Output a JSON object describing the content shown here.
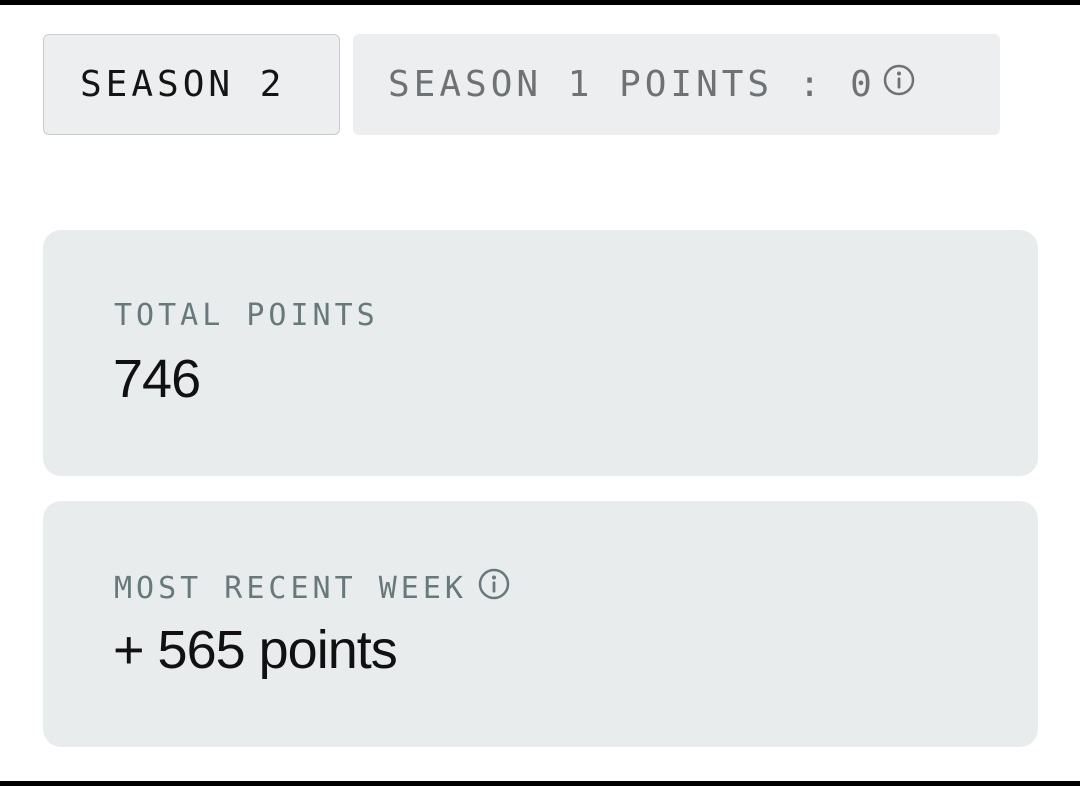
{
  "tabs": {
    "active": {
      "label": "SEASON 2"
    },
    "inactive": {
      "label": "SEASON 1 POINTS : 0",
      "icon": "info-icon"
    }
  },
  "cards": {
    "total": {
      "label": "TOTAL POINTS",
      "value": "746"
    },
    "recent": {
      "label": "MOST RECENT WEEK",
      "icon": "info-icon",
      "value": "+ 565 points"
    }
  },
  "colors": {
    "card_bg": "#e9eced",
    "tab_bg": "#eceeef",
    "label": "#667a7c",
    "value": "#111111"
  }
}
